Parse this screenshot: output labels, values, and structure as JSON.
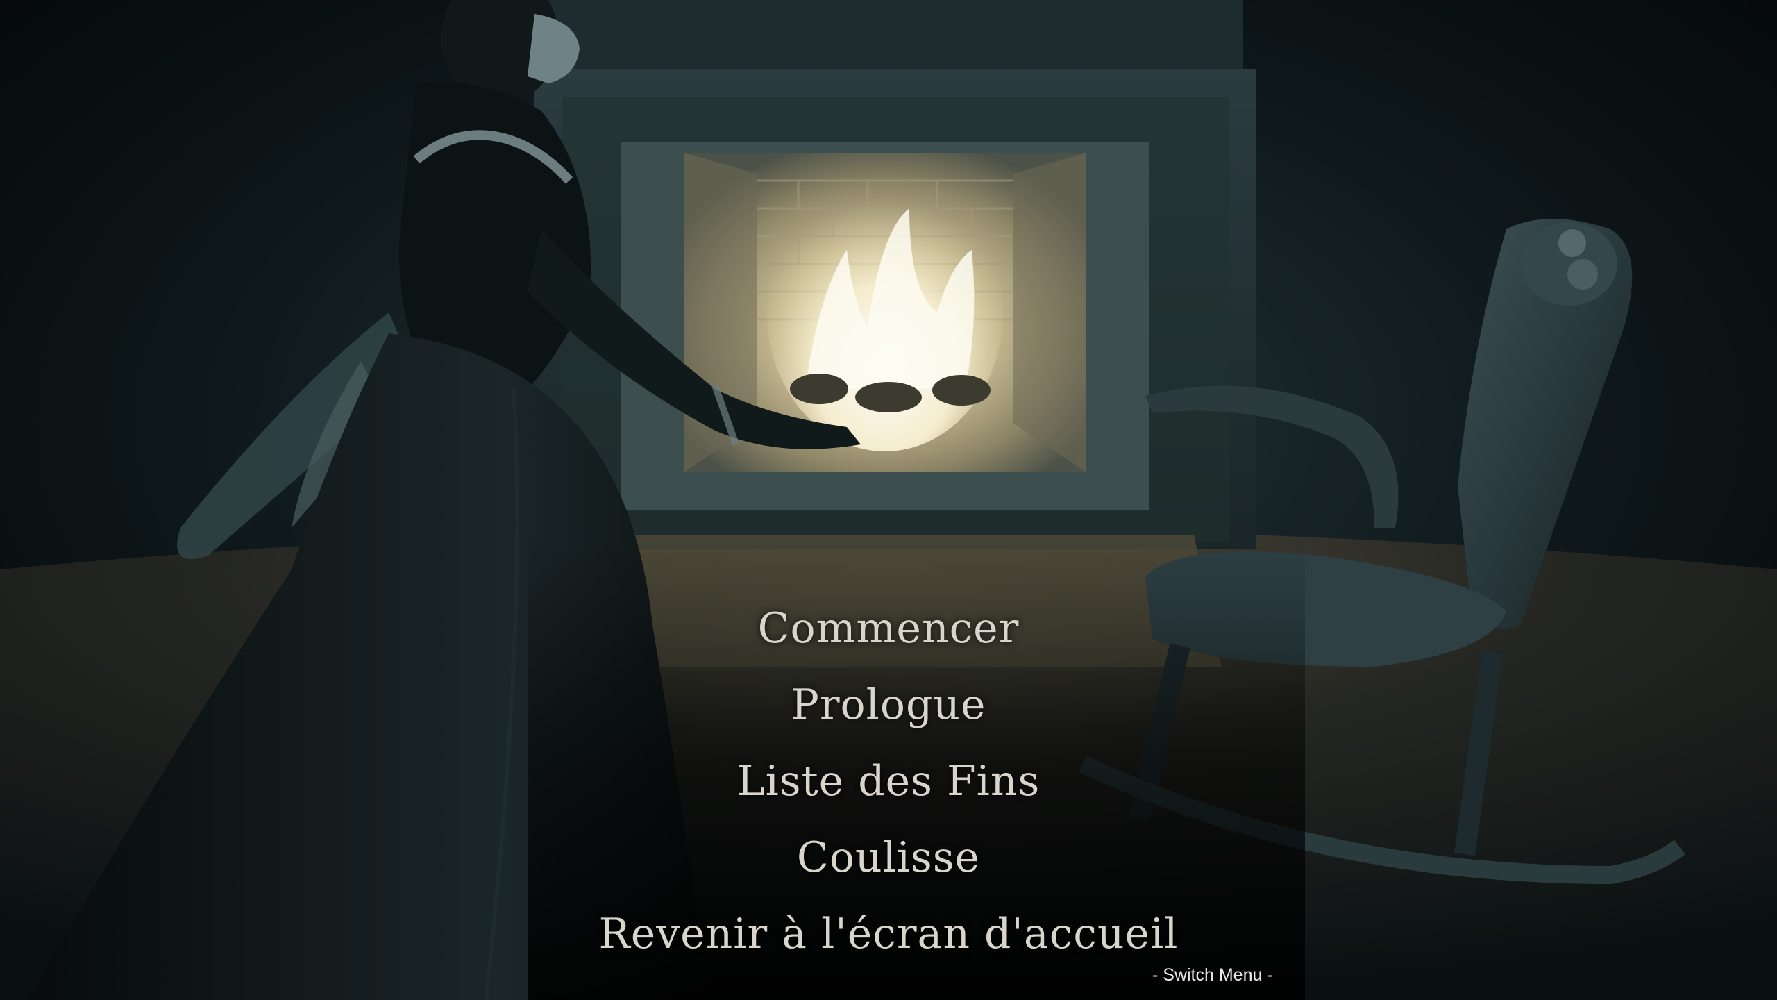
{
  "menu": {
    "items": [
      {
        "label": "Commencer"
      },
      {
        "label": "Prologue"
      },
      {
        "label": "Liste des Fins"
      },
      {
        "label": "Coulisse"
      },
      {
        "label": "Revenir à l'écran d'accueil"
      }
    ]
  },
  "switch_menu": {
    "label": "- Switch Menu -"
  },
  "scene": {
    "palette": {
      "background": "#050809",
      "shadow_teal": "#1a2b30",
      "stone": "#3a4c50",
      "fire_glow": "#f1e8c6",
      "hearth_sepia": "#6b5f45",
      "menu_text": "#d9d5cc"
    }
  }
}
